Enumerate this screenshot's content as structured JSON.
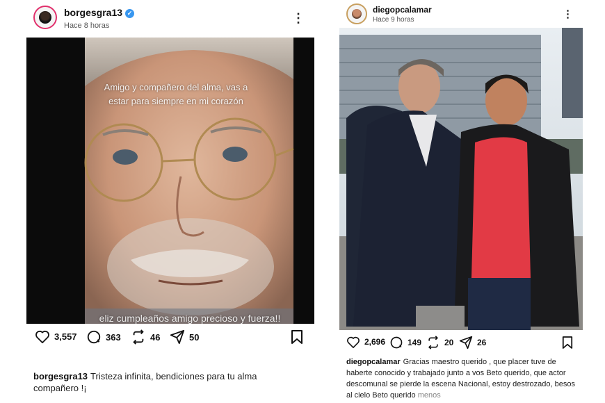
{
  "posts": [
    {
      "username": "borgesgra13",
      "verified": true,
      "time": "Hace 8 horas",
      "overlay_text_top": "Amigo y compañero del alma, vas a estar para siempre en mi corazón",
      "overlay_text_bottom": "eliz cumpleaños amigo precioso y fuerza!!",
      "likes": "3,557",
      "comments": "363",
      "reposts": "46",
      "shares": "50",
      "caption": "Tristeza infinita, bendiciones para tu alma compañero !¡"
    },
    {
      "username": "diegopcalamar",
      "verified": false,
      "time": "Hace 9 horas",
      "likes": "2,696",
      "comments": "149",
      "reposts": "20",
      "shares": "26",
      "caption": "Gracias maestro querido , que placer tuve de haberte conocido y trabajado junto a vos Beto querido, que actor descomunal se pierde la escena Nacional, estoy destrozado, besos al cielo Beto querido",
      "more_label": "menos"
    }
  ],
  "icons": {
    "like": "heart-icon",
    "comment": "comment-icon",
    "repost": "repost-icon",
    "share": "send-icon",
    "save": "bookmark-icon",
    "options": "more-options-icon",
    "verified": "verified-badge-icon"
  },
  "colors": {
    "verified": "#3897f0",
    "story_ring": "#e1306c",
    "shirt_red": "#e23a45"
  }
}
